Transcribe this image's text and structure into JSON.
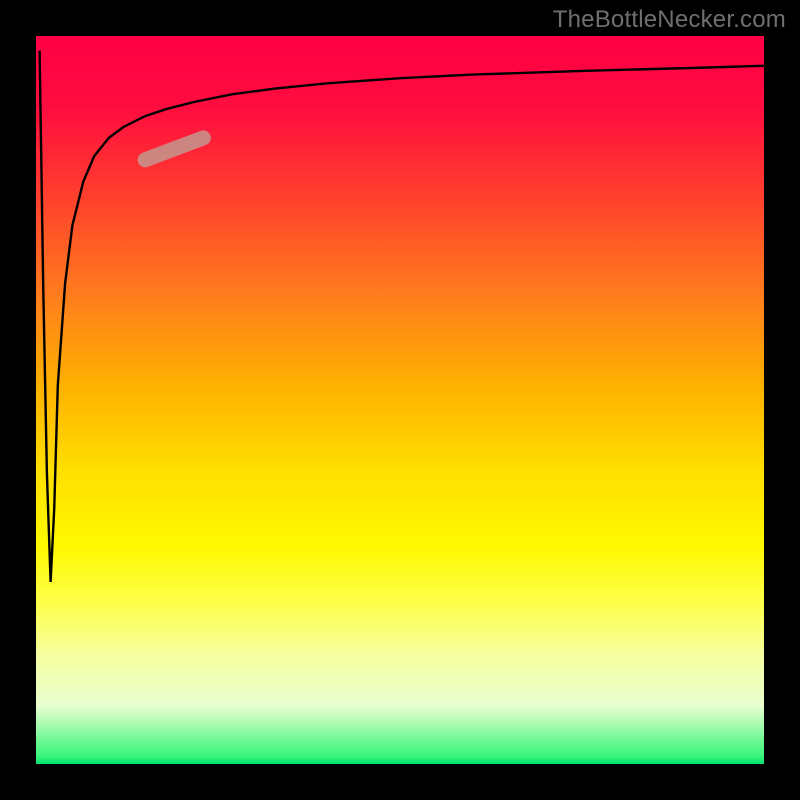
{
  "watermark": "TheBottleNecker.com",
  "chart_data": {
    "type": "line",
    "title": "",
    "xlabel": "",
    "ylabel": "",
    "xlim": [
      0,
      100
    ],
    "ylim": [
      0,
      100
    ],
    "axes_visible": false,
    "background": "gradient-red-to-green-vertical",
    "series": [
      {
        "name": "bottleneck-curve",
        "x": [
          0.5,
          1,
          1.5,
          2.0,
          2.5,
          3.0,
          4.0,
          5.0,
          6.5,
          8.0,
          10,
          12,
          15,
          18,
          22,
          27,
          33,
          40,
          50,
          60,
          75,
          90,
          100
        ],
        "y": [
          98,
          65,
          40,
          25,
          35,
          52,
          66,
          74,
          80,
          83.5,
          86,
          87.5,
          89,
          90,
          91,
          92,
          92.8,
          93.5,
          94.2,
          94.7,
          95.2,
          95.6,
          95.9
        ]
      }
    ],
    "highlight": {
      "name": "highlight-segment",
      "x_range": [
        15,
        23
      ],
      "approx_y": [
        83,
        86
      ],
      "color": "#c6938b"
    }
  }
}
